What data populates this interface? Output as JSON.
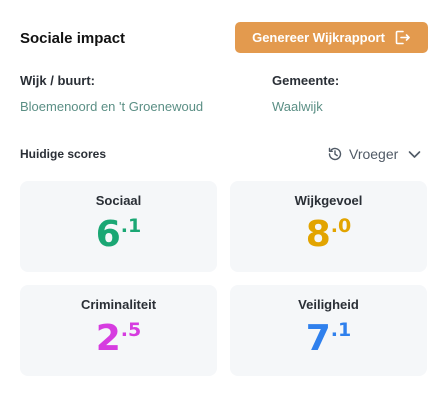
{
  "header": {
    "title": "Sociale impact",
    "report_button_label": "Genereer Wijkrapport",
    "report_button_color": "#e39a4e"
  },
  "location": {
    "neighbourhood_label": "Wijk / buurt:",
    "neighbourhood_value": "Bloemenoord en 't Groenewoud",
    "municipality_label": "Gemeente:",
    "municipality_value": "Waalwijk"
  },
  "scores": {
    "section_label": "Huidige scores",
    "history_label": "Vroeger",
    "items": [
      {
        "name": "Sociaal",
        "int": "6",
        "dec": ".1",
        "color": "#1aa774"
      },
      {
        "name": "Wijkgevoel",
        "int": "8",
        "dec": ".0",
        "color": "#e2a400"
      },
      {
        "name": "Criminaliteit",
        "int": "2",
        "dec": ".5",
        "color": "#d63ce0"
      },
      {
        "name": "Veiligheid",
        "int": "7",
        "dec": ".1",
        "color": "#2f80ed"
      }
    ]
  },
  "icons": {
    "report_button_icon": "export-icon",
    "history_icon": "history-icon",
    "dropdown_icon": "chevron-down-icon"
  }
}
